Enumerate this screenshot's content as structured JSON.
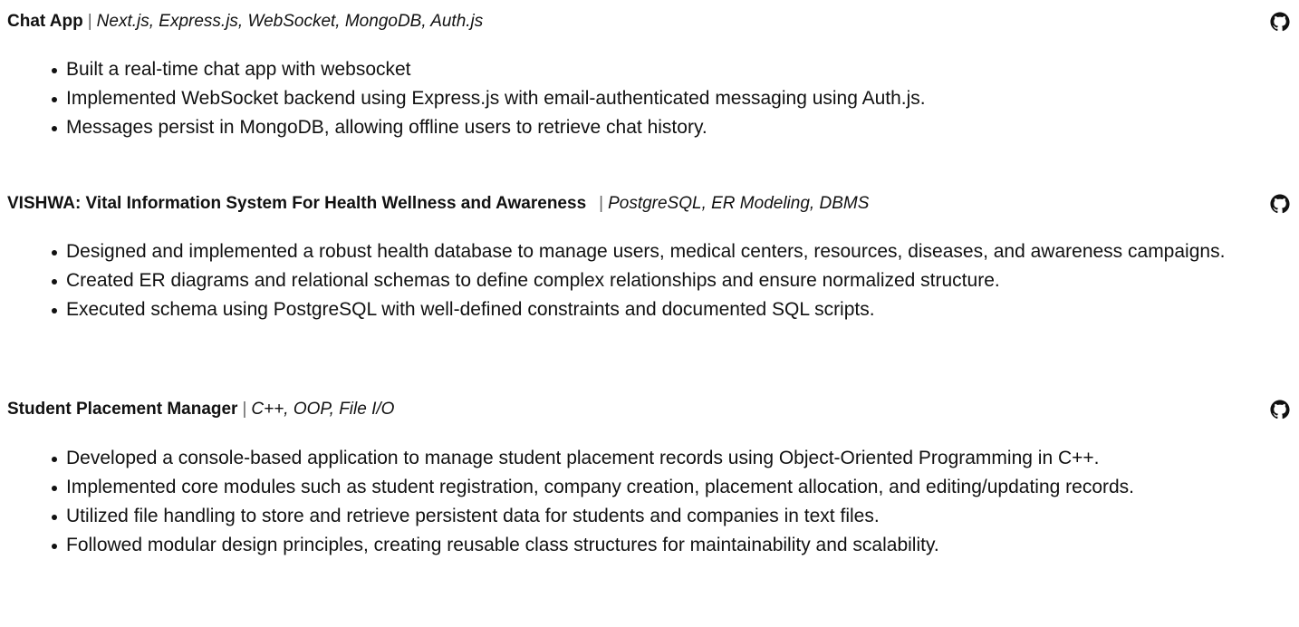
{
  "projects": [
    {
      "name": "Chat App",
      "separator": "|",
      "tech": "Next.js, Express.js, WebSocket, MongoDB, Auth.js",
      "icon": "github-icon",
      "bullets": [
        "Built a real-time chat app with websocket",
        "Implemented WebSocket backend using Express.js with email-authenticated messaging using Auth.js.",
        "Messages persist in MongoDB, allowing offline users to retrieve chat history."
      ]
    },
    {
      "name": "VISHWA: Vital Information System For Health Wellness and Awareness",
      "separator": "|",
      "tech": "PostgreSQL, ER Modeling, DBMS",
      "icon": "github-icon",
      "bullets": [
        "Designed and implemented a robust health database to manage users, medical centers, resources, diseases, and awareness campaigns.",
        "Created ER diagrams and relational schemas to define complex relationships and ensure normalized structure.",
        "Executed schema using PostgreSQL with well-defined constraints and documented SQL scripts."
      ]
    },
    {
      "name": "Student Placement Manager",
      "separator": "|",
      "tech": "C++, OOP, File I/O",
      "icon": "github-icon",
      "bullets": [
        "Developed a console-based application to manage student placement records using Object-Oriented Programming in C++.",
        "Implemented core modules such as student registration, company creation, placement allocation, and editing/updating records.",
        "Utilized file handling to store and retrieve persistent data for students and companies in text files.",
        "Followed modular design principles, creating reusable class structures for maintainability and scalability."
      ]
    }
  ]
}
